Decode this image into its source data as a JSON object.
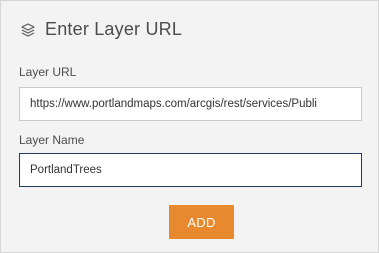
{
  "panel": {
    "title": "Enter Layer URL",
    "icon": "layers-icon"
  },
  "layer_url": {
    "label": "Layer URL",
    "value": "https://www.portlandmaps.com/arcgis/rest/services/Publi"
  },
  "layer_name": {
    "label": "Layer Name",
    "value": "PortlandTrees"
  },
  "actions": {
    "add_label": "ADD"
  },
  "colors": {
    "accent": "#e8892f",
    "panel_bg": "#f3f3f3",
    "text": "#4c4c4c",
    "focus_border": "#1f3a5a"
  }
}
